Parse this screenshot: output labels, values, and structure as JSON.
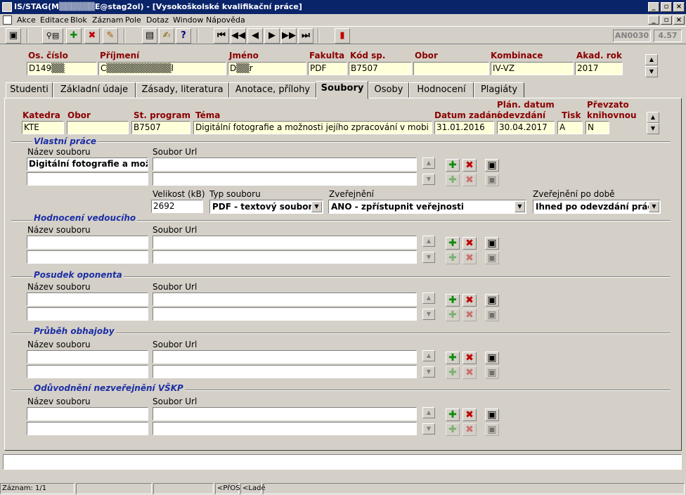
{
  "window": {
    "title": "IS/STAG(M▒▒▒▒▒▒E@stag2ol) - [Vysokoškolské kvalifikační práce]"
  },
  "menu": [
    "Akce",
    "Editace",
    "Blok",
    "Záznam",
    "Pole",
    "Dotaz",
    "Window",
    "Nápověda"
  ],
  "toolbar": {
    "form_code": "AN0030",
    "version": "4.57"
  },
  "header": {
    "labels": {
      "os_cislo": "Os. číslo",
      "prijmeni": "Příjmení",
      "jmeno": "Jméno",
      "fakulta": "Fakulta",
      "kod_sp": "Kód sp.",
      "obor": "Obor",
      "kombinace": "Kombinace",
      "akad_rok": "Akad. rok"
    },
    "values": {
      "os_cislo": "D149▒▒",
      "prijmeni": "C▒▒▒▒▒▒▒▒▒▒l",
      "jmeno": "D▒▒r",
      "fakulta": "PDF",
      "kod_sp": "B7507",
      "obor": "",
      "kombinace": "IV-VZ",
      "akad_rok": "2017"
    }
  },
  "tabs": [
    "Studenti",
    "Základní údaje",
    "Zásady, literatura",
    "Anotace, přílohy",
    "Soubory",
    "Osoby",
    "Hodnocení",
    "Plagiáty"
  ],
  "active_tab": "Soubory",
  "work": {
    "labels": {
      "katedra": "Katedra",
      "obor": "Obor",
      "st_program": "St. program",
      "tema": "Téma",
      "datum_zadani": "Datum zadání",
      "plan_datum_1": "Plán. datum",
      "plan_datum_2": "odevzdání",
      "tisk": "Tisk",
      "prevzato_1": "Převzato",
      "prevzato_2": "knihovnou"
    },
    "values": {
      "katedra": "KTE",
      "obor": "",
      "st_program": "B7507",
      "tema": "Digitální fotografie a možnosti jejího zpracování v mobi",
      "datum_zadani": "31.01.2016",
      "plan_datum": "30.04.2017",
      "tisk": "A",
      "prevzato": "N"
    }
  },
  "file_labels": {
    "nazev": "Název souboru",
    "url": "Soubor Url",
    "velikost": "Velikost (kB)",
    "typ": "Typ souboru",
    "zverejneni": "Zveřejnění",
    "zverejneni_po": "Zveřejnění po době"
  },
  "sections": [
    {
      "title": "Vlastní práce",
      "rows": [
        {
          "name": "Digitální fotografie a možno",
          "url": ""
        },
        {
          "name": "",
          "url": ""
        }
      ],
      "velikost": "2692",
      "typ": "PDF - textový soubor",
      "zverejneni": "ANO - zpřístupnit veřejnosti",
      "zverejneni_po": "Ihned po odevzdání práce"
    },
    {
      "title": "Hodnocení vedoucího",
      "rows": [
        {
          "name": "",
          "url": ""
        },
        {
          "name": "",
          "url": ""
        }
      ]
    },
    {
      "title": "Posudek oponenta",
      "rows": [
        {
          "name": "",
          "url": ""
        },
        {
          "name": "",
          "url": ""
        }
      ]
    },
    {
      "title": "Průběh obhajoby",
      "rows": [
        {
          "name": "",
          "url": ""
        },
        {
          "name": "",
          "url": ""
        }
      ]
    },
    {
      "title": "Odůvodnění nezveřejnění VŠKP",
      "rows": [
        {
          "name": "",
          "url": ""
        },
        {
          "name": "",
          "url": ""
        }
      ]
    }
  ],
  "status": {
    "record": "Záznam: 1/1",
    "c1": "<PřOS",
    "c2": "<Ladě"
  }
}
